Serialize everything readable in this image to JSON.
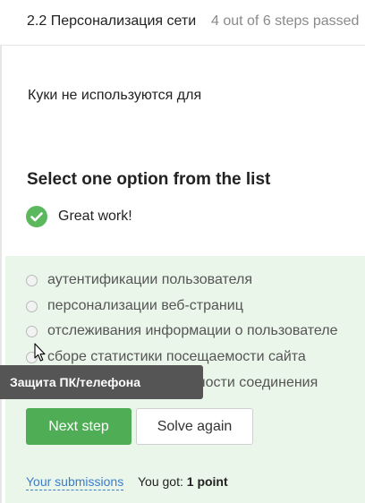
{
  "header": {
    "lesson_title": "2.2 Персонализация сети",
    "progress": "4 out of 6 steps passed"
  },
  "question": {
    "text": "Куки не используются для"
  },
  "quiz": {
    "instruction": "Select one option from the list",
    "feedback": "Great work!",
    "options": [
      {
        "label": "аутентификации пользователя",
        "selected": false
      },
      {
        "label": "персонализации веб-страниц",
        "selected": false
      },
      {
        "label": "отслеживания информации о пользователе",
        "selected": false
      },
      {
        "label": "сборе статистики посещаемости сайта",
        "selected": false
      },
      {
        "label": "улучшения надежности соединения",
        "selected": false
      }
    ],
    "visible_option_fragments": {
      "option_5": "дежности соединения"
    }
  },
  "tooltip": {
    "text": "Защита ПК/телефона"
  },
  "actions": {
    "next_label": "Next step",
    "solve_again_label": "Solve again"
  },
  "footer": {
    "submissions_link": "Your submissions",
    "score_prefix": "You got:",
    "score_value": "1 point"
  },
  "colors": {
    "accent_green": "#4fae55",
    "panel_bg": "#eaf6ea",
    "link_blue": "#3d7cc9",
    "tooltip_bg": "#555555"
  },
  "icons": {
    "check": "checkmark-circle-icon",
    "cursor": "mouse-pointer-icon"
  }
}
